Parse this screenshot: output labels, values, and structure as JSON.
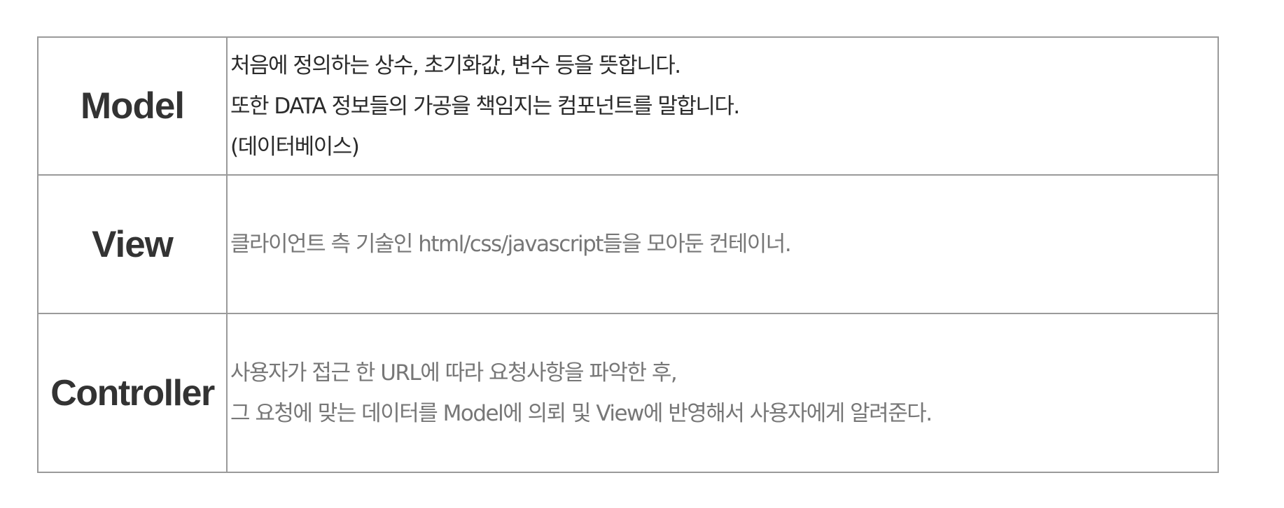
{
  "rows": [
    {
      "term": "Model",
      "lines": [
        "처음에 정의하는 상수, 초기화값, 변수 등을 뜻합니다.",
        "또한 DATA 정보들의 가공을 책임지는 컴포넌트를 말합니다.",
        "(데이터베이스)"
      ]
    },
    {
      "term": "View",
      "lines": [
        "클라이언트 측 기술인 html/css/javascript들을 모아둔 컨테이너."
      ]
    },
    {
      "term": "Controller",
      "lines": [
        "사용자가 접근 한 URL에 따라 요청사항을 파악한 후,",
        "그 요청에 맞는 데이터를 Model에 의뢰 및 View에 반영해서 사용자에게 알려준다."
      ]
    }
  ],
  "colors": {
    "border": "#9a9a9a",
    "term_text": "#333333",
    "model_desc_text": "#2b2b2b",
    "other_desc_text": "#777777"
  }
}
